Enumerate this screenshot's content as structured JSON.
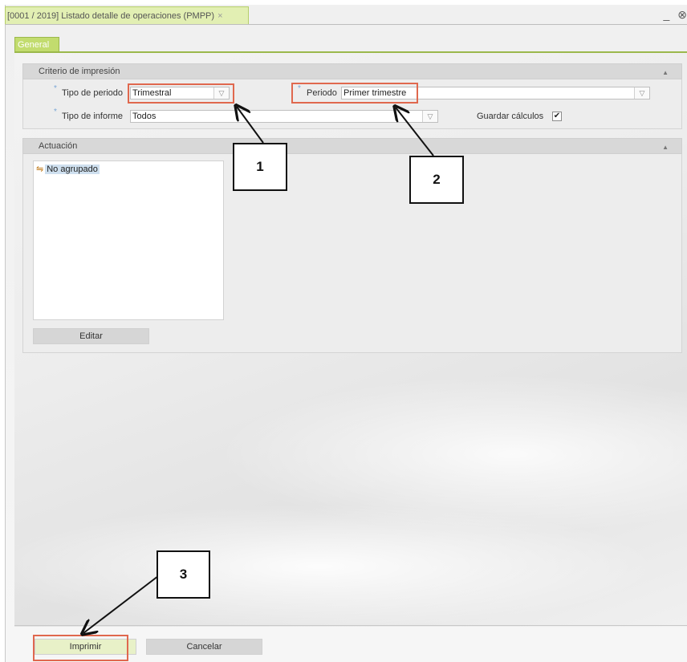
{
  "window": {
    "title": "[0001 / 2019] Listado detalle de operaciones (PMPP)",
    "close_glyph": "×",
    "minimize_glyph": "_",
    "close_window_glyph": "⊗"
  },
  "tabs": [
    {
      "label": "General",
      "active": true
    }
  ],
  "criterio": {
    "title": "Criterio de impresión",
    "tipo_periodo": {
      "label": "Tipo de periodo",
      "value": "Trimestral"
    },
    "periodo": {
      "label": "Periodo",
      "value": "Primer trimestre"
    },
    "tipo_informe": {
      "label": "Tipo de informe",
      "value": "Todos"
    },
    "guardar_calculos": {
      "label": "Guardar cálculos",
      "checked": true,
      "mark": "✔"
    },
    "required_marker": "*",
    "collapse_glyph": "▲",
    "dropdown_glyph": "▽"
  },
  "actuacion": {
    "title": "Actuación",
    "tree_items": [
      {
        "label": "No agrupado",
        "icon": "grouping-icon"
      }
    ],
    "edit_button": "Editar"
  },
  "footer": {
    "print_button": "Imprimir",
    "cancel_button": "Cancelar"
  },
  "callouts": [
    "1",
    "2",
    "3"
  ],
  "colors": {
    "accent_green": "#c2dc6e",
    "highlight": "#e0684e",
    "panel_header": "#d8d8d8"
  }
}
